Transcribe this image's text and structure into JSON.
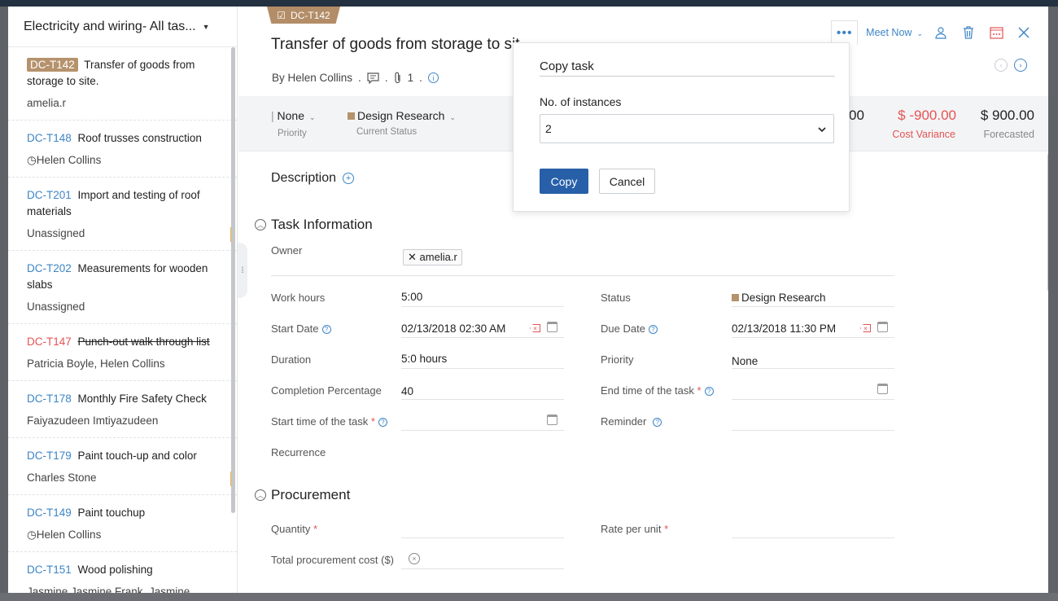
{
  "list": {
    "header": "Electricity and wiring- All tas...",
    "tasks": [
      {
        "id": "DC-T142",
        "title": "Transfer of goods from storage to site.",
        "sub": "amelia.r"
      },
      {
        "id": "DC-T148",
        "title": "Roof trusses construction",
        "sub": "Helen Collins"
      },
      {
        "id": "DC-T201",
        "title": "Import and testing of roof materials",
        "sub": "Unassigned"
      },
      {
        "id": "DC-T202",
        "title": "Measurements for wooden slabs",
        "sub": "Unassigned"
      },
      {
        "id": "DC-T147",
        "title": "Punch-out walk through list",
        "sub": "Patricia Boyle, Helen Collins"
      },
      {
        "id": "DC-T178",
        "title": "Monthly Fire Safety Check",
        "sub": "Faiyazudeen Imtiyazudeen"
      },
      {
        "id": "DC-T179",
        "title": "Paint touch-up and color",
        "sub": "Charles Stone"
      },
      {
        "id": "DC-T149",
        "title": "Paint touchup",
        "sub": "Helen Collins"
      },
      {
        "id": "DC-T151",
        "title": "Wood polishing",
        "sub": "Jasmine Jasmine Frank, Jasmine"
      }
    ]
  },
  "detail": {
    "tag": "DC-T142",
    "title": "Transfer of goods from storage to sit",
    "by": "By Helen Collins",
    "sep": ".",
    "attach_count": "1",
    "toolbar": {
      "meet": "Meet Now"
    },
    "band": {
      "priority_value": "None",
      "priority_label": "Priority",
      "status_value": "Design Research",
      "status_label": "Current Status",
      "partial": "00",
      "cost_variance_value": "$ -900.00",
      "cost_variance_label": "Cost Variance",
      "forecasted_value": "$ 900.00",
      "forecasted_label": "Forecasted"
    },
    "description": "Description",
    "task_info": "Task Information",
    "procurement": "Procurement",
    "fields": {
      "owner_label": "Owner",
      "owner_value": "amelia.r",
      "work_hours_label": "Work hours",
      "work_hours_value": "5:00",
      "status_label": "Status",
      "status_value": "Design Research",
      "start_date_label": "Start Date",
      "start_date_value": "02/13/2018 02:30 AM",
      "due_date_label": "Due Date",
      "due_date_value": "02/13/2018 11:30 PM",
      "duration_label": "Duration",
      "duration_value": "5:0 hours",
      "priority_label": "Priority",
      "priority_value": "None",
      "completion_label": "Completion Percentage",
      "completion_value": "40",
      "end_time_label": "End time of the task",
      "start_time_label": "Start time of the task",
      "reminder_label": "Reminder",
      "recurrence_label": "Recurrence",
      "quantity_label": "Quantity",
      "rate_label": "Rate per unit",
      "total_cost_label": "Total procurement cost ($)"
    }
  },
  "popup": {
    "title": "Copy task",
    "instances_label": "No. of instances",
    "instances_value": "2",
    "copy": "Copy",
    "cancel": "Cancel"
  },
  "colors": {
    "accent": "#3d85c6",
    "primary_button": "#2760a8",
    "tag": "#b38d67",
    "negative": "#e55353"
  }
}
